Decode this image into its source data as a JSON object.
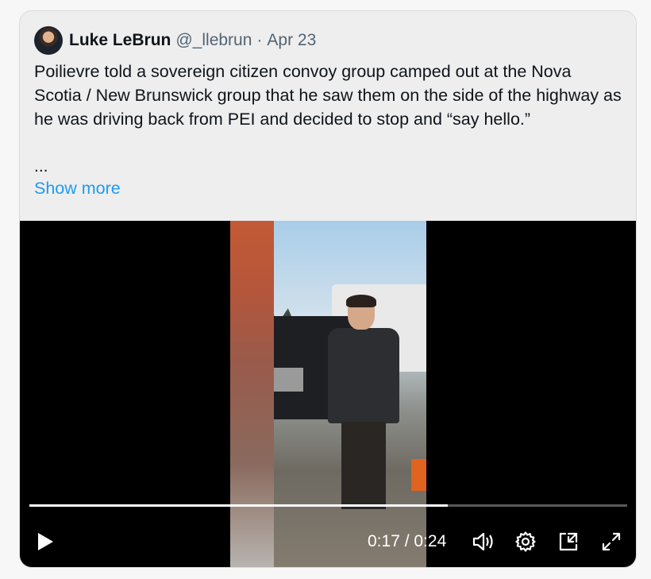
{
  "tweet": {
    "author_name": "Luke LeBrun",
    "handle": "@_llebrun",
    "separator": "·",
    "date": "Apr 23",
    "text": "Poilievre told a sovereign citizen convoy group camped out at the Nova Scotia / New Brunswick group that he saw them on the side of the highway as he was driving back from PEI and decided to stop and “say hello.”",
    "ellipsis": "...",
    "show_more_label": "Show more",
    "link_color": "#1d9bf0"
  },
  "video": {
    "current_time": "0:17",
    "duration": "0:24",
    "time_display": "0:17 / 0:24",
    "progress": 0.7,
    "icons": {
      "play": "play-icon",
      "volume": "volume-icon",
      "settings": "gear-icon",
      "pip": "picture-in-picture-icon",
      "fullscreen": "fullscreen-icon"
    }
  }
}
